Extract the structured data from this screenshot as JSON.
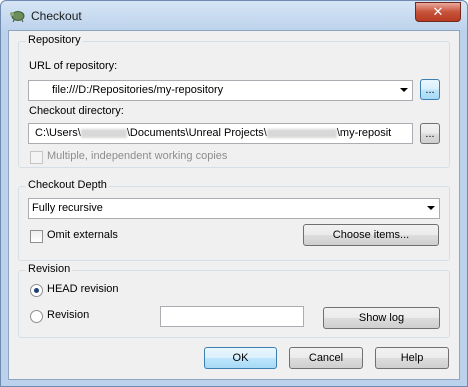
{
  "window": {
    "title": "Checkout",
    "close_symbol": "✕"
  },
  "repository": {
    "group_label": "Repository",
    "url_label": "URL of repository:",
    "url_value": "file:///D:/Repositories/my-repository",
    "browse_label": "...",
    "dir_label": "Checkout directory:",
    "dir_part1": "C:\\Users\\",
    "dir_part2": "\\Documents\\Unreal Projects\\",
    "dir_part3": "\\my-reposit",
    "dir_browse_label": "...",
    "multiple_label": "Multiple, independent working copies",
    "multiple_checked": false
  },
  "depth": {
    "group_label": "Checkout Depth",
    "selected": "Fully recursive",
    "omit_label": "Omit externals",
    "omit_checked": false,
    "choose_label": "Choose items..."
  },
  "revision": {
    "group_label": "Revision",
    "head_label": "HEAD revision",
    "head_selected": true,
    "revision_label": "Revision",
    "revision_value": "",
    "showlog_label": "Show log"
  },
  "buttons": {
    "ok": "OK",
    "cancel": "Cancel",
    "help": "Help"
  }
}
